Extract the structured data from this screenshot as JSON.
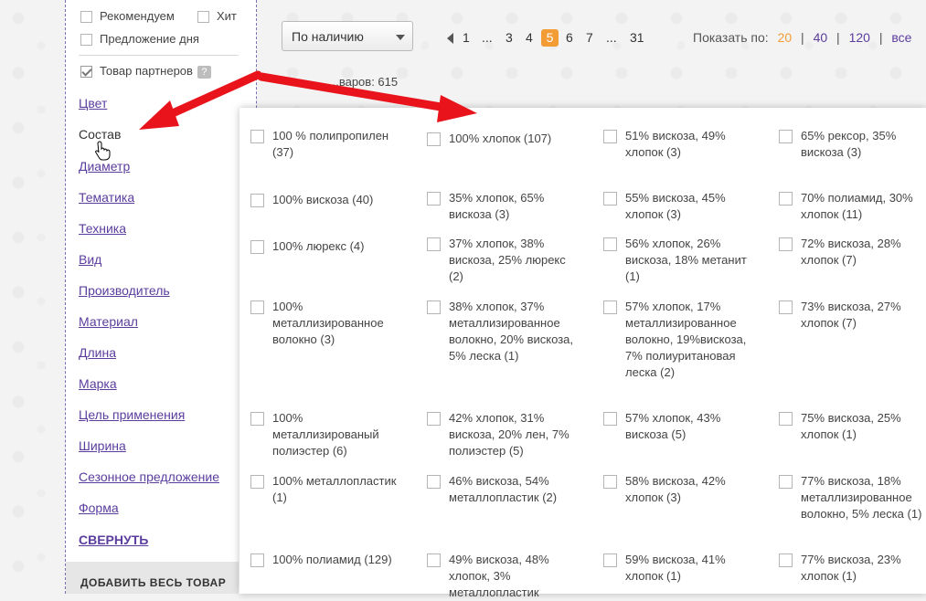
{
  "sidebar": {
    "checkboxes": [
      {
        "label": "Рекомендуем",
        "checked": false
      },
      {
        "label": "Хит",
        "checked": false
      },
      {
        "label": "Предложение дня",
        "checked": false
      },
      {
        "label": "Товар партнеров",
        "checked": true
      }
    ],
    "help_glyph": "?",
    "filters": [
      "Цвет",
      "Состав",
      "Диаметр",
      "Тематика",
      "Техника",
      "Вид",
      "Производитель",
      "Материал",
      "Длина",
      "Марка",
      "Цель применения",
      "Ширина",
      "Сезонное предложение",
      "Форма"
    ],
    "collapse_label": "СВЕРНУТЬ",
    "add_all_label": "ДОБАВИТЬ ВЕСЬ ТОВАР"
  },
  "toolbar": {
    "sort_value": "По наличию",
    "pagination": [
      "1",
      "...",
      "3",
      "4",
      "5",
      "6",
      "7",
      "...",
      "31"
    ],
    "current_page": "5",
    "show_label": "Показать по:",
    "show_options": [
      "20",
      "40",
      "120",
      "все"
    ],
    "show_current": "20",
    "show_separator": "|",
    "count_text": "...варов: 615"
  },
  "composition_panel": {
    "options": [
      [
        "100 % полипропилен (37)",
        "100% хлопок (107)",
        "51% вискоза, 49% хлопок (3)",
        "65% рексор, 35% вискоза (3)"
      ],
      [
        "100% вискоза (40)",
        "35% хлопок, 65% вискоза (3)",
        "55% вискоза, 45% хлопок (3)",
        "70% полиамид, 30% хлопок (11)"
      ],
      [
        "100% люрекс (4)",
        "37% хлопок, 38% вискоза, 25% люрекс (2)",
        "56% хлопок, 26% вискоза, 18% метанит (1)",
        "72% вискоза, 28% хлопок (7)"
      ],
      [
        "100% металлизированное волокно (3)",
        "38% хлопок, 37% металлизированное волокно, 20% вискоза, 5% леска (1)",
        "57% хлопок, 17% металлизированное волокно, 19%вискоза, 7% полиуритановая леска (2)",
        "73% вискоза, 27% хлопок (7)"
      ],
      [
        "100% металлизированый полиэстер (6)",
        "42% хлопок, 31% вискоза, 20% лен, 7% полиэстер (5)",
        "57% хлопок, 43% вискоза (5)",
        "75% вискоза, 25% хлопок (1)"
      ],
      [
        "100% металлопластик (1)",
        "46% вискоза, 54% металлопластик (2)",
        "58% вискоза, 42% хлопок (3)",
        "77% вискоза, 18% металлизированное волокно, 5% леска (1)"
      ],
      [
        "100% полиамид (129)",
        "49% вискоза, 48% хлопок, 3% металлопластик",
        "59% вискоза, 41% хлопок (1)",
        "77% вискоза, 23% хлопок (1)"
      ]
    ]
  },
  "annotation": {
    "arrow_color": "#e8131b"
  }
}
